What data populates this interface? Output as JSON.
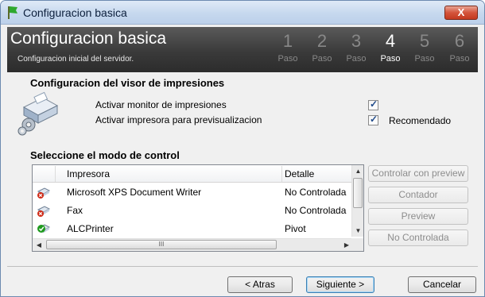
{
  "window": {
    "title": "Configuracion basica",
    "close_label": "X"
  },
  "header": {
    "title": "Configuracion basica",
    "subtitle": "Configuracion inicial del servidor.",
    "steps": [
      {
        "num": "1",
        "label": "Paso"
      },
      {
        "num": "2",
        "label": "Paso"
      },
      {
        "num": "3",
        "label": "Paso"
      },
      {
        "num": "4",
        "label": "Paso"
      },
      {
        "num": "5",
        "label": "Paso"
      },
      {
        "num": "6",
        "label": "Paso"
      }
    ],
    "active_step": 4
  },
  "viewer": {
    "title": "Configuracion del visor de impresiones",
    "option1": "Activar monitor de impresiones",
    "option2": "Activar impresora para previsualizacion",
    "option1_checked": true,
    "option2_checked": true,
    "recommended": "Recomendado"
  },
  "control": {
    "title": "Seleccione el modo de control",
    "columns": {
      "printer": "Impresora",
      "detail": "Detalle"
    },
    "rows": [
      {
        "name": "Microsoft XPS Document Writer",
        "detail": "No Controlada",
        "icon": "printer-x-icon"
      },
      {
        "name": "Fax",
        "detail": "No Controlada",
        "icon": "printer-x-icon"
      },
      {
        "name": "ALCPrinter",
        "detail": "Pivot",
        "icon": "printer-check-icon"
      }
    ],
    "hscroll_grip": "III",
    "buttons": {
      "controlar_preview": "Controlar con preview",
      "contador": "Contador",
      "preview": "Preview",
      "no_controlada": "No Controlada"
    }
  },
  "footer": {
    "back": "< Atras",
    "next": "Siguiente >",
    "cancel": "Cancelar"
  },
  "colors": {
    "header_bg": "#3a3a3a",
    "accent_green": "#1f9a1f",
    "error_red": "#d02a16"
  }
}
